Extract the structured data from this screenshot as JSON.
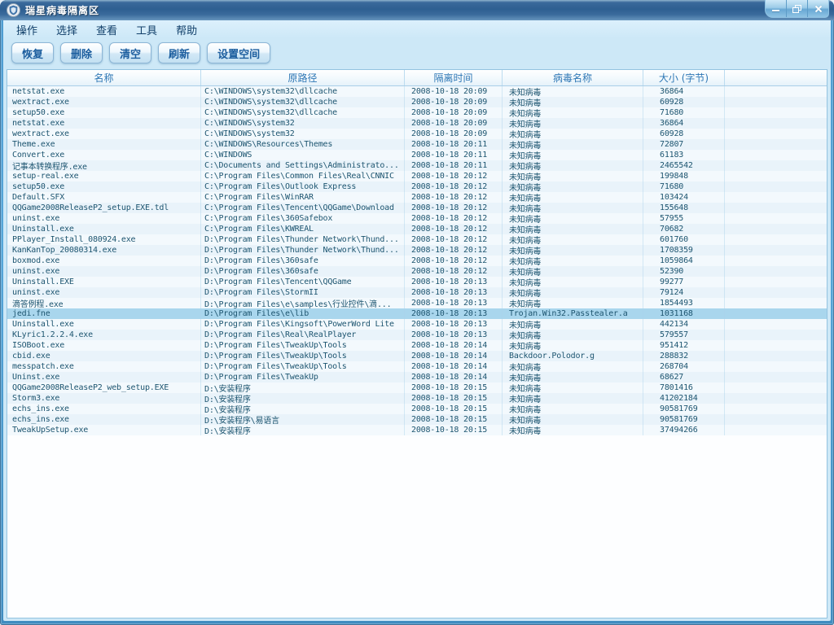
{
  "window": {
    "title": "瑞星病毒隔离区",
    "icons": {
      "logo": "rising-shield-logo",
      "minimize": "minimize-icon",
      "restore": "restore-icon",
      "close": "close-icon"
    }
  },
  "menu": {
    "items": [
      "操作",
      "选择",
      "查看",
      "工具",
      "帮助"
    ]
  },
  "toolbar": {
    "buttons": [
      "恢复",
      "删除",
      "清空",
      "刷新",
      "设置空间"
    ]
  },
  "table": {
    "columns": [
      "名称",
      "原路径",
      "隔离时间",
      "病毒名称",
      "大小 (字节)"
    ],
    "selected_index": 21,
    "rows": [
      [
        "netstat.exe",
        "C:\\WINDOWS\\system32\\dllcache",
        "2008-10-18 20:09",
        "未知病毒",
        "36864"
      ],
      [
        "wextract.exe",
        "C:\\WINDOWS\\system32\\dllcache",
        "2008-10-18 20:09",
        "未知病毒",
        "60928"
      ],
      [
        "setup50.exe",
        "C:\\WINDOWS\\system32\\dllcache",
        "2008-10-18 20:09",
        "未知病毒",
        "71680"
      ],
      [
        "netstat.exe",
        "C:\\WINDOWS\\system32",
        "2008-10-18 20:09",
        "未知病毒",
        "36864"
      ],
      [
        "wextract.exe",
        "C:\\WINDOWS\\system32",
        "2008-10-18 20:09",
        "未知病毒",
        "60928"
      ],
      [
        "Theme.exe",
        "C:\\WINDOWS\\Resources\\Themes",
        "2008-10-18 20:11",
        "未知病毒",
        "72807"
      ],
      [
        "Convert.exe",
        "C:\\WINDOWS",
        "2008-10-18 20:11",
        "未知病毒",
        "61183"
      ],
      [
        "记事本转换程序.exe",
        "C:\\Documents and Settings\\Administrato...",
        "2008-10-18 20:11",
        "未知病毒",
        "2465542"
      ],
      [
        "setup-real.exe",
        "C:\\Program Files\\Common Files\\Real\\CNNIC",
        "2008-10-18 20:12",
        "未知病毒",
        "199848"
      ],
      [
        "setup50.exe",
        "C:\\Program Files\\Outlook Express",
        "2008-10-18 20:12",
        "未知病毒",
        "71680"
      ],
      [
        "Default.SFX",
        "C:\\Program Files\\WinRAR",
        "2008-10-18 20:12",
        "未知病毒",
        "103424"
      ],
      [
        "QQGame2008ReleaseP2_setup.EXE.tdl",
        "C:\\Program Files\\Tencent\\QQGame\\Download",
        "2008-10-18 20:12",
        "未知病毒",
        "155648"
      ],
      [
        "uninst.exe",
        "C:\\Program Files\\360Safebox",
        "2008-10-18 20:12",
        "未知病毒",
        "57955"
      ],
      [
        "Uninstall.exe",
        "C:\\Program Files\\KWREAL",
        "2008-10-18 20:12",
        "未知病毒",
        "70682"
      ],
      [
        "PPlayer_Install_080924.exe",
        "D:\\Program Files\\Thunder Network\\Thund...",
        "2008-10-18 20:12",
        "未知病毒",
        "601760"
      ],
      [
        "KanKanTop_20080314.exe",
        "D:\\Program Files\\Thunder Network\\Thund...",
        "2008-10-18 20:12",
        "未知病毒",
        "1708359"
      ],
      [
        "boxmod.exe",
        "D:\\Program Files\\360safe",
        "2008-10-18 20:12",
        "未知病毒",
        "1059864"
      ],
      [
        "uninst.exe",
        "D:\\Program Files\\360safe",
        "2008-10-18 20:12",
        "未知病毒",
        "52390"
      ],
      [
        "Uninstall.EXE",
        "D:\\Program Files\\Tencent\\QQGame",
        "2008-10-18 20:13",
        "未知病毒",
        "99277"
      ],
      [
        "uninst.exe",
        "D:\\Program Files\\StormII",
        "2008-10-18 20:13",
        "未知病毒",
        "79124"
      ],
      [
        "滴答例程.exe",
        "D:\\Program Files\\e\\samples\\行业控件\\滴...",
        "2008-10-18 20:13",
        "未知病毒",
        "1854493"
      ],
      [
        "jedi.fne",
        "D:\\Program Files\\e\\lib",
        "2008-10-18 20:13",
        "Trojan.Win32.Passtealer.a",
        "1031168"
      ],
      [
        "Uninstall.exe",
        "D:\\Program Files\\Kingsoft\\PowerWord Lite",
        "2008-10-18 20:13",
        "未知病毒",
        "442134"
      ],
      [
        "KLyric1.2.2.4.exe",
        "D:\\Program Files\\Real\\RealPlayer",
        "2008-10-18 20:13",
        "未知病毒",
        "579557"
      ],
      [
        "ISOBoot.exe",
        "D:\\Program Files\\TweakUp\\Tools",
        "2008-10-18 20:14",
        "未知病毒",
        "951412"
      ],
      [
        "cbid.exe",
        "D:\\Program Files\\TweakUp\\Tools",
        "2008-10-18 20:14",
        "Backdoor.Polodor.g",
        "288832"
      ],
      [
        "messpatch.exe",
        "D:\\Program Files\\TweakUp\\Tools",
        "2008-10-18 20:14",
        "未知病毒",
        "268704"
      ],
      [
        "Uninst.exe",
        "D:\\Program Files\\TweakUp",
        "2008-10-18 20:14",
        "未知病毒",
        "68627"
      ],
      [
        "QQGame2008ReleaseP2_web_setup.EXE",
        "D:\\安装程序",
        "2008-10-18 20:15",
        "未知病毒",
        "7801416"
      ],
      [
        "Storm3.exe",
        "D:\\安装程序",
        "2008-10-18 20:15",
        "未知病毒",
        "41202184"
      ],
      [
        "echs_ins.exe",
        "D:\\安装程序",
        "2008-10-18 20:15",
        "未知病毒",
        "90581769"
      ],
      [
        "echs_ins.exe",
        "D:\\安装程序\\易语言",
        "2008-10-18 20:15",
        "未知病毒",
        "90581769"
      ],
      [
        "TweakUpSetup.exe",
        "D:\\安装程序",
        "2008-10-18 20:15",
        "未知病毒",
        "37494266"
      ]
    ]
  },
  "colors": {
    "titlebar": "#2e5f91",
    "frame": "#55a4d7",
    "client_bg": "#cde8f7",
    "selection": "#a9d6ed",
    "header_text": "#2e77b5",
    "row_text": "#1d5570",
    "button_text": "#1b5d9e"
  }
}
